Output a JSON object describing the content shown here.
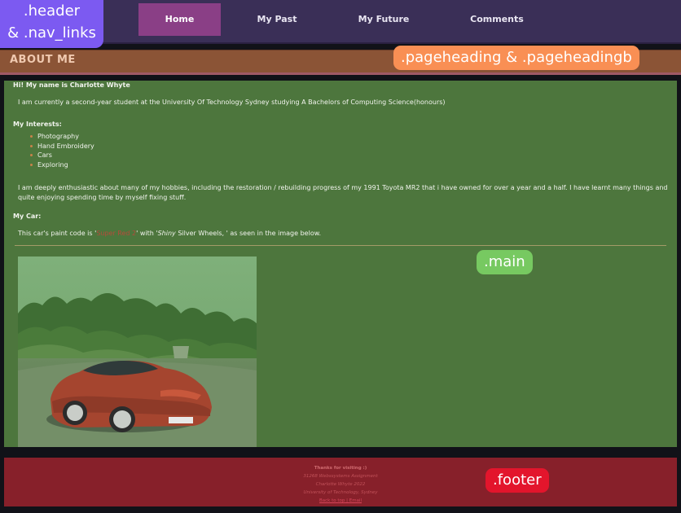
{
  "nav": {
    "links": [
      {
        "label": "Home"
      },
      {
        "label": "My Past"
      },
      {
        "label": "My Future"
      },
      {
        "label": "Comments"
      }
    ]
  },
  "page": {
    "heading": "ABOUT ME"
  },
  "main": {
    "greeting": "Hi! My name is Charlotte Whyte",
    "intro": "I am currently a second-year student at the University Of Technology Sydney studying A Bachelors of Computing Science(honours)",
    "interests_heading": "My Interests:",
    "interests": [
      "Photography",
      "Hand Embroidery",
      "Cars",
      "Exploring"
    ],
    "enthusiasm": "I am deeply enthusiastic about many of my hobbies, including the restoration / rebuilding progress of my 1991 Toyota MR2 that i have owned for over a year and a half. I have learnt many things and quite enjoying spending time by myself fixing stuff.",
    "car_heading": "My Car:",
    "paint_prefix": "This car's paint code is '",
    "paint_code": "Super Red 2",
    "paint_mid": "' with '",
    "paint_wheels_italic": "Shiny",
    "paint_wheels": " Silver Wheels, '",
    "paint_suffix": " as seen in the image below."
  },
  "footer": {
    "thanks": "Thanks for visiting :)",
    "line1": "31268 Webssystems Assignment",
    "line2": "Charlotte Whyte 2022",
    "line3": "University of Technology, Sydney",
    "link": "Back to top | Email"
  },
  "annotations": {
    "header": ".header",
    "header2": "& .nav_links",
    "pageheading": ".pageheading & .pageheadingb",
    "main": ".main",
    "footer": ".footer"
  },
  "colors": {
    "header_bg": "#3a2f57",
    "nav_active": "#8a3f86",
    "pageheading_bg": "#8b5436",
    "main_bg": "#4d763d",
    "footer_bg": "#87202a"
  }
}
